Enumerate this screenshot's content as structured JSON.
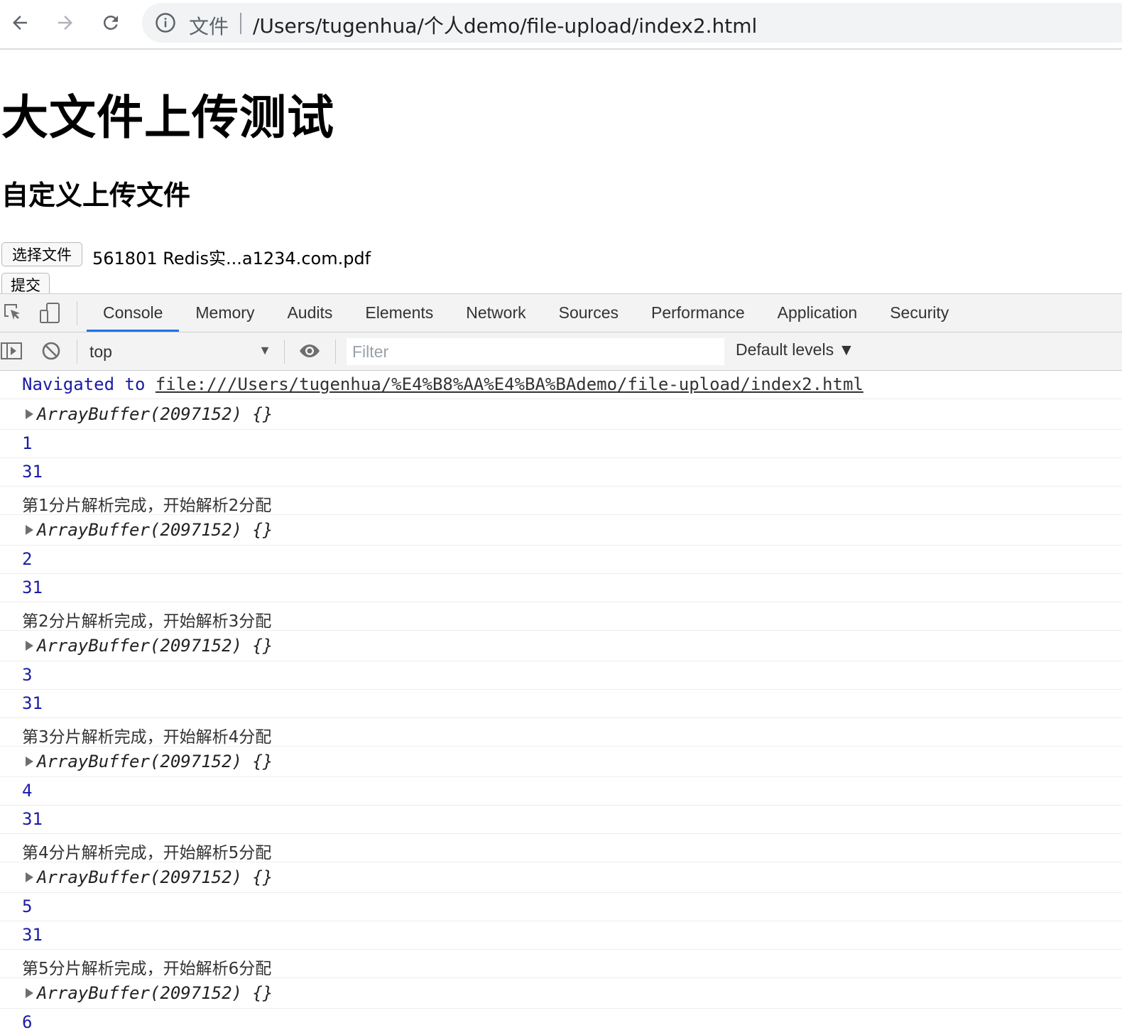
{
  "browser": {
    "scheme_label": "文件",
    "url": "/Users/tugenhua/个人demo/file-upload/index2.html"
  },
  "page": {
    "title": "大文件上传测试",
    "subtitle": "自定义上传文件",
    "choose_file_label": "选择文件",
    "file_name": "561801 Redis实...a1234.com.pdf",
    "submit_label": "提交"
  },
  "devtools": {
    "tabs": [
      "Console",
      "Memory",
      "Audits",
      "Elements",
      "Network",
      "Sources",
      "Performance",
      "Application",
      "Security"
    ],
    "active_tab": "Console",
    "context": "top",
    "filter_placeholder": "Filter",
    "levels": "Default levels ▼"
  },
  "console": {
    "nav_prefix": "Navigated to",
    "nav_url": "file:///Users/tugenhua/%E4%B8%AA%E4%BA%BAdemo/file-upload/index2.html",
    "entries": [
      {
        "type": "obj",
        "text": "ArrayBuffer(2097152) {}"
      },
      {
        "type": "num",
        "text": "1"
      },
      {
        "type": "num",
        "text": "31"
      },
      {
        "type": "msg",
        "text": "第1分片解析完成，开始解析2分配"
      },
      {
        "type": "obj",
        "text": "ArrayBuffer(2097152) {}"
      },
      {
        "type": "num",
        "text": "2"
      },
      {
        "type": "num",
        "text": "31"
      },
      {
        "type": "msg",
        "text": "第2分片解析完成，开始解析3分配"
      },
      {
        "type": "obj",
        "text": "ArrayBuffer(2097152) {}"
      },
      {
        "type": "num",
        "text": "3"
      },
      {
        "type": "num",
        "text": "31"
      },
      {
        "type": "msg",
        "text": "第3分片解析完成，开始解析4分配"
      },
      {
        "type": "obj",
        "text": "ArrayBuffer(2097152) {}"
      },
      {
        "type": "num",
        "text": "4"
      },
      {
        "type": "num",
        "text": "31"
      },
      {
        "type": "msg",
        "text": "第4分片解析完成，开始解析5分配"
      },
      {
        "type": "obj",
        "text": "ArrayBuffer(2097152) {}"
      },
      {
        "type": "num",
        "text": "5"
      },
      {
        "type": "num",
        "text": "31"
      },
      {
        "type": "msg",
        "text": "第5分片解析完成，开始解析6分配"
      },
      {
        "type": "obj",
        "text": "ArrayBuffer(2097152) {}"
      },
      {
        "type": "num",
        "text": "6"
      }
    ]
  }
}
